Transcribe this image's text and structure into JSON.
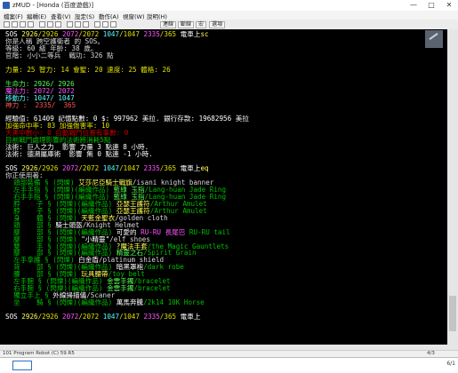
{
  "window": {
    "title": "zMUD - [Honda (百度遊戲)]",
    "min": "—",
    "max": "□",
    "close": "✕"
  },
  "menu": [
    "檔案(F)",
    "編輯(E)",
    "查看(V)",
    "設定(S)",
    "動作(A)",
    "視窗(W)",
    "說明(H)"
  ],
  "toolbar": {
    "buttons": [
      "連線",
      "斷線",
      "宏",
      "選項"
    ]
  },
  "terminal": {
    "lines": [
      [
        [
          "SOS ",
          "W"
        ],
        [
          "2926",
          "Y"
        ],
        [
          "/2926 ",
          "y"
        ],
        [
          "2072",
          "M"
        ],
        [
          "/2072 ",
          "y"
        ],
        [
          "1047",
          "C"
        ],
        [
          "/1047 ",
          "y"
        ],
        [
          "2335",
          "M"
        ],
        [
          "/365 ",
          "y"
        ],
        [
          "電車上",
          "W"
        ],
        [
          "sc",
          "Y"
        ]
      ],
      [
        [
          "你是人稱 跨空護衛者 的 SOS。",
          "w"
        ]
      ],
      [
        [
          "等級: 60 級 年齡: 38 歲。",
          "w"
        ]
      ],
      [
        [
          "官階: 小小二等兵  戰功: 326 點",
          "w"
        ]
      ],
      [
        [
          "",
          "w"
        ]
      ],
      [
        [
          "力量: 25 智力: 14 會聖: 20 速度: 25 體格: 26",
          "y"
        ]
      ],
      [
        [
          "",
          "w"
        ]
      ],
      [
        [
          "生命力: 2926/ 2926",
          "G"
        ]
      ],
      [
        [
          "魔法力: 2072/ 2072",
          "M"
        ]
      ],
      [
        [
          "移動力: 1047/ 1047",
          "C"
        ]
      ],
      [
        [
          "神力 :  2335/  365",
          "R"
        ]
      ],
      [
        [
          "",
          "w"
        ]
      ],
      [
        [
          "經驗值: 61409 記憶點數: 0 $: 997962 美拉. 銀行存款: 19682956 美拉",
          "W"
        ]
      ],
      [
        [
          "加強命中率: 83 加強傷害率: 10",
          "y"
        ]
      ],
      [
        [
          "天黑中數小: 0 自動戰鬥位置有事數: 0",
          "r"
        ]
      ],
      [
        [
          "目前戰鬥處理影響的法術將消耗5點",
          "g"
        ]
      ],
      [
        [
          "法術: 巨人之力  影響 力量 3 點連 8 小時.",
          "W"
        ]
      ],
      [
        [
          "法術: 德瀕屬庫術  影響 無 0 點連 -1 小時.",
          "W"
        ]
      ],
      [
        [
          "",
          "w"
        ]
      ],
      [
        [
          "SOS ",
          "W"
        ],
        [
          "2926",
          "Y"
        ],
        [
          "/2926 ",
          "y"
        ],
        [
          "2072",
          "M"
        ],
        [
          "/2072 ",
          "y"
        ],
        [
          "1047",
          "C"
        ],
        [
          "/1047 ",
          "y"
        ],
        [
          "2335",
          "M"
        ],
        [
          "/365 ",
          "y"
        ],
        [
          "電車上",
          "W"
        ],
        [
          "eq",
          "Y"
        ]
      ],
      [
        [
          "你正使用著:",
          "w"
        ]
      ],
      [
        [
          "  ",
          "w"
        ],
        [
          "頭部裝備",
          "g"
        ],
        [
          " § ",
          "g"
        ],
        [
          "(閃爍) ",
          "g"
        ],
        [
          "艾莎尼亞騎士戰旗",
          "Y"
        ],
        [
          "/isani knight banner",
          "w"
        ]
      ],
      [
        [
          "  ",
          "w"
        ],
        [
          "左手手指",
          "g"
        ],
        [
          " § ",
          "g"
        ],
        [
          "(閃爍)(編織作品) ",
          "g"
        ],
        [
          "藍綠 玉指",
          "G"
        ],
        [
          "/Lang-huan Jade Ring",
          "g"
        ]
      ],
      [
        [
          "  ",
          "w"
        ],
        [
          "右手手指",
          "g"
        ],
        [
          " § ",
          "g"
        ],
        [
          "(閃爍)(編織作品) ",
          "g"
        ],
        [
          "藍綠 玉指",
          "G"
        ],
        [
          "/Lang-huan Jade Ring",
          "g"
        ]
      ],
      [
        [
          "  ",
          "w"
        ],
        [
          "脖    子",
          "g"
        ],
        [
          " § ",
          "g"
        ],
        [
          "(閃爍)(編織作品) ",
          "g"
        ],
        [
          "亞瑟王護符",
          "Y"
        ],
        [
          "/Arthur Amulet",
          "g"
        ]
      ],
      [
        [
          "  ",
          "w"
        ],
        [
          "脖    子",
          "g"
        ],
        [
          " § ",
          "g"
        ],
        [
          "(閃爍)(編織作品) ",
          "g"
        ],
        [
          "亞瑟王護符",
          "Y"
        ],
        [
          "/Arthur Amulet",
          "g"
        ]
      ],
      [
        [
          "  ",
          "w"
        ],
        [
          "身    體",
          "g"
        ],
        [
          " § ",
          "g"
        ],
        [
          "(閃爍) ",
          "g"
        ],
        [
          "天藍金聖衣",
          "Y"
        ],
        [
          "/golden cloth",
          "w"
        ]
      ],
      [
        [
          "  ",
          "w"
        ],
        [
          "頭    部",
          "g"
        ],
        [
          " § ",
          "g"
        ],
        [
          "騎士頭盔",
          "W"
        ],
        [
          "/Knight Helmet",
          "w"
        ]
      ],
      [
        [
          "  ",
          "w"
        ],
        [
          "腳    部",
          "g"
        ],
        [
          " § ",
          "g"
        ],
        [
          "(閃爍)(編織作品) ",
          "g"
        ],
        [
          "可愛的 ",
          "W"
        ],
        [
          "RU-RU 長尾巴",
          "M"
        ],
        [
          " RU-RU tail",
          "g"
        ]
      ],
      [
        [
          "  ",
          "w"
        ],
        [
          "腳    部",
          "g"
        ],
        [
          " § ",
          "g"
        ],
        [
          "(閃爍) ",
          "g"
        ],
        [
          "\"小精靈\"",
          "W"
        ],
        [
          "/elf shoes",
          "w"
        ]
      ],
      [
        [
          "  ",
          "w"
        ],
        [
          "雙    手",
          "g"
        ],
        [
          " § ",
          "g"
        ],
        [
          "(閃爍)(編織作品) ",
          "g"
        ],
        [
          "?",
          "Y"
        ],
        [
          "魔法手套",
          "Y"
        ],
        [
          "/the Magic Gauntlets",
          "g"
        ]
      ],
      [
        [
          "  ",
          "w"
        ],
        [
          "腳    部",
          "g"
        ],
        [
          " § ",
          "g"
        ],
        [
          "(閃爍)(編織作品) ",
          "g"
        ],
        [
          "精靈之石",
          "G"
        ],
        [
          "/Spirit Grain",
          "g"
        ]
      ],
      [
        [
          "  ",
          "w"
        ],
        [
          "左手拿護",
          "g"
        ],
        [
          " § ",
          "g"
        ],
        [
          "(閃爍) ",
          "g"
        ],
        [
          "白金盾",
          "W"
        ],
        [
          "/platinum shield",
          "w"
        ]
      ],
      [
        [
          "  ",
          "w"
        ],
        [
          "背    部",
          "g"
        ],
        [
          " § ",
          "g"
        ],
        [
          "(閃爍)(編織作品) ",
          "g"
        ],
        [
          "暗黑罩袍",
          "W"
        ],
        [
          "/dark robe",
          "g"
        ]
      ],
      [
        [
          "  ",
          "w"
        ],
        [
          "腰    部",
          "g"
        ],
        [
          " § ",
          "g"
        ],
        [
          "(閃爍) ",
          "g"
        ],
        [
          "玩具腰帶",
          "Y"
        ],
        [
          "/toy belt",
          "g"
        ]
      ],
      [
        [
          "  ",
          "w"
        ],
        [
          "左手腕",
          "g"
        ],
        [
          " § ",
          "g"
        ],
        [
          "(閃爍)(編織作品) ",
          "g"
        ],
        [
          "金雲手鐲",
          "G"
        ],
        [
          "/bracelet",
          "g"
        ]
      ],
      [
        [
          "  ",
          "w"
        ],
        [
          "右手腕",
          "g"
        ],
        [
          " § ",
          "g"
        ],
        [
          "(閃爍)(編織作品) ",
          "g"
        ],
        [
          "金雲手鐲",
          "G"
        ],
        [
          "/bracelet",
          "g"
        ]
      ],
      [
        [
          "  ",
          "w"
        ],
        [
          "獨立手上",
          "g"
        ],
        [
          " § ",
          "g"
        ],
        [
          "外線掃描儀",
          "W"
        ],
        [
          "/Scaner",
          "w"
        ]
      ],
      [
        [
          "  ",
          "w"
        ],
        [
          "坐    騎",
          "g"
        ],
        [
          " § ",
          "g"
        ],
        [
          "(閃爍)(編織作品) ",
          "g"
        ],
        [
          "萬馬奔騰",
          "W"
        ],
        [
          "/2k14 10K Horse",
          "g"
        ]
      ],
      [
        [
          "",
          "w"
        ]
      ],
      [
        [
          "SOS ",
          "W"
        ],
        [
          "2926",
          "Y"
        ],
        [
          "/2926 ",
          "y"
        ],
        [
          "2072",
          "M"
        ],
        [
          "/2072 ",
          "y"
        ],
        [
          "1047",
          "C"
        ],
        [
          "/1047 ",
          "y"
        ],
        [
          "2335",
          "M"
        ],
        [
          "/365 ",
          "y"
        ],
        [
          "電車上",
          "W"
        ]
      ]
    ]
  },
  "status": {
    "left": "101 Program Robot (C) 59.R5",
    "right": "4/3"
  },
  "clock": "6/1"
}
